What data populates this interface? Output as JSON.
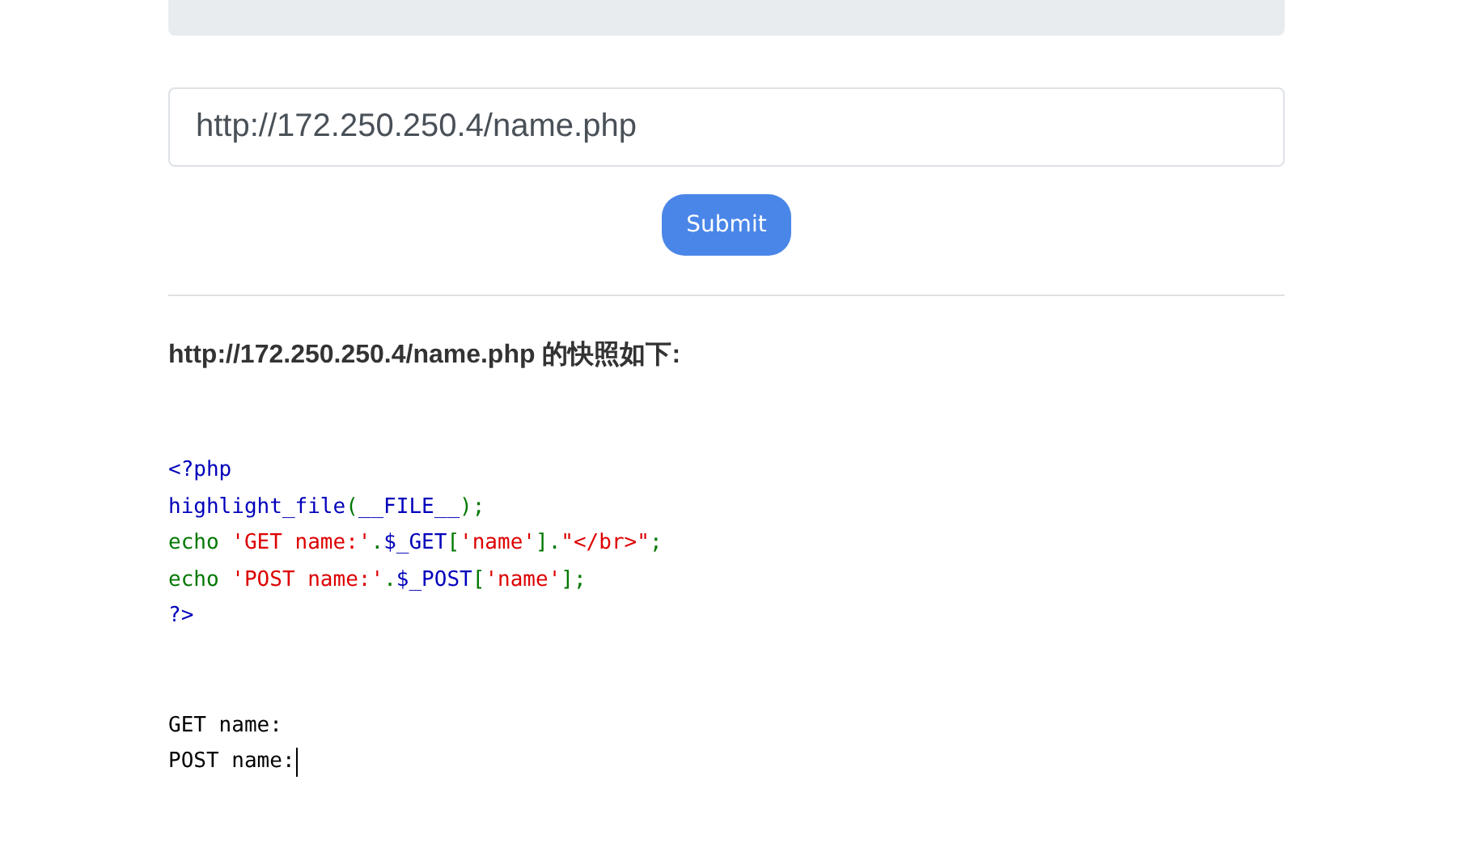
{
  "url_field": {
    "value": "http://172.250.250.4/name.php"
  },
  "submit_button": {
    "label": "Submit"
  },
  "snapshot_heading": "http://172.250.250.4/name.php 的快照如下:",
  "code_lines": [
    [
      {
        "kind": "default",
        "text": "<?php"
      }
    ],
    [
      {
        "kind": "default",
        "text": "highlight_file"
      },
      {
        "kind": "keyword",
        "text": "("
      },
      {
        "kind": "default",
        "text": "__FILE__"
      },
      {
        "kind": "keyword",
        "text": ");"
      }
    ],
    [
      {
        "kind": "keyword",
        "text": "echo "
      },
      {
        "kind": "string",
        "text": "'GET name:'"
      },
      {
        "kind": "keyword",
        "text": "."
      },
      {
        "kind": "default",
        "text": "$_GET"
      },
      {
        "kind": "keyword",
        "text": "["
      },
      {
        "kind": "string",
        "text": "'name'"
      },
      {
        "kind": "keyword",
        "text": "]."
      },
      {
        "kind": "string",
        "text": "\"</br>\""
      },
      {
        "kind": "keyword",
        "text": ";"
      }
    ],
    [
      {
        "kind": "keyword",
        "text": "echo "
      },
      {
        "kind": "string",
        "text": "'POST name:'"
      },
      {
        "kind": "keyword",
        "text": "."
      },
      {
        "kind": "default",
        "text": "$_POST"
      },
      {
        "kind": "keyword",
        "text": "["
      },
      {
        "kind": "string",
        "text": "'name'"
      },
      {
        "kind": "keyword",
        "text": "];"
      }
    ],
    [
      {
        "kind": "default",
        "text": "?>"
      }
    ]
  ],
  "output_lines": [
    "GET name:",
    "POST name:"
  ]
}
